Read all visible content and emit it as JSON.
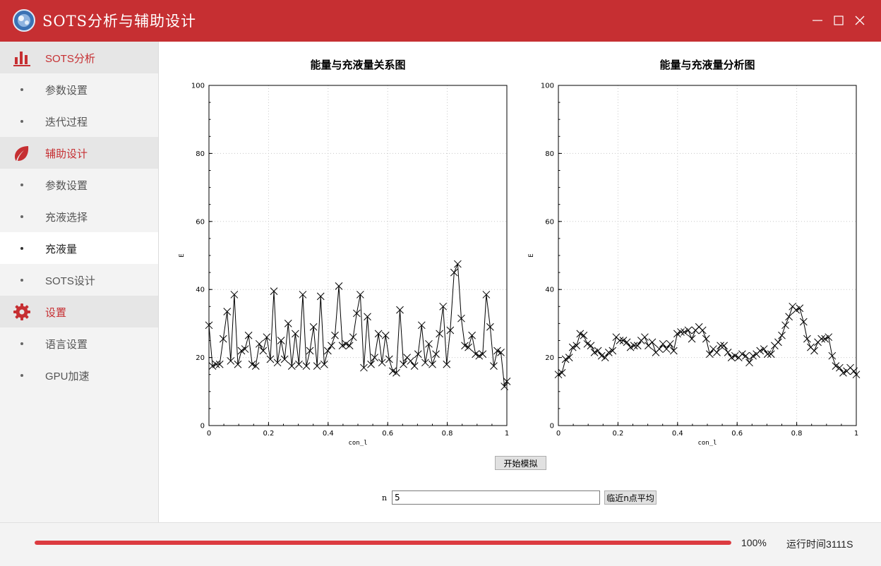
{
  "app": {
    "title": "SOTS分析与辅助设计"
  },
  "window_controls": {
    "minimize": "minimize-icon",
    "maximize": "maximize-icon",
    "close": "close-icon"
  },
  "colors": {
    "brand": "#c62f32",
    "progress": "#dc3b40",
    "sidebar_bg": "#f3f3f3"
  },
  "sidebar": {
    "groups": [
      {
        "label": "SOTS分析",
        "icon": "bar-chart-icon",
        "items": [
          {
            "label": "参数设置"
          },
          {
            "label": "迭代过程"
          }
        ]
      },
      {
        "label": "辅助设计",
        "icon": "leaf-icon",
        "items": [
          {
            "label": "参数设置"
          },
          {
            "label": "充液选择"
          },
          {
            "label": "充液量",
            "active": true
          },
          {
            "label": "SOTS设计"
          }
        ]
      },
      {
        "label": "设置",
        "icon": "gear-icon",
        "items": [
          {
            "label": "语言设置"
          },
          {
            "label": "GPU加速"
          }
        ]
      }
    ]
  },
  "controls": {
    "start_button": "开始模拟",
    "n_label": "n",
    "n_value": "5",
    "average_button": "临近n点平均"
  },
  "status": {
    "progress_text": "100%",
    "progress_fraction": 1.0,
    "runtime": "运行时间3111S"
  },
  "chart_data": [
    {
      "type": "line",
      "title": "能量与充液量关系图",
      "xlabel": "con_l",
      "ylabel": "E",
      "xlim": [
        0,
        1
      ],
      "ylim": [
        0,
        100
      ],
      "xticks": [
        "0",
        "0.2",
        "0.4",
        "0.6",
        "0.8",
        "1"
      ],
      "yticks": [
        "0",
        "20",
        "40",
        "60",
        "80",
        "100"
      ],
      "grid": true,
      "marker": "x",
      "series": [
        {
          "x": [
            0.0,
            0.012,
            0.024,
            0.036,
            0.048,
            0.061,
            0.073,
            0.085,
            0.097,
            0.109,
            0.121,
            0.133,
            0.145,
            0.157,
            0.169,
            0.182,
            0.194,
            0.206,
            0.218,
            0.23,
            0.242,
            0.254,
            0.266,
            0.278,
            0.29,
            0.302,
            0.315,
            0.327,
            0.339,
            0.351,
            0.363,
            0.375,
            0.387,
            0.399,
            0.411,
            0.423,
            0.436,
            0.448,
            0.46,
            0.472,
            0.484,
            0.496,
            0.508,
            0.52,
            0.532,
            0.544,
            0.556,
            0.569,
            0.581,
            0.593,
            0.605,
            0.617,
            0.629,
            0.641,
            0.653,
            0.665,
            0.677,
            0.69,
            0.702,
            0.714,
            0.726,
            0.738,
            0.75,
            0.762,
            0.774,
            0.786,
            0.798,
            0.81,
            0.823,
            0.835,
            0.847,
            0.859,
            0.871,
            0.883,
            0.895,
            0.907,
            0.919,
            0.931,
            0.944,
            0.956,
            0.968,
            0.98,
            0.992,
            1.0
          ],
          "y": [
            29.5,
            17.5,
            18,
            18,
            25.5,
            33.5,
            19,
            38.5,
            18,
            22,
            22.5,
            26.5,
            18,
            17.5,
            24,
            22,
            26,
            19.5,
            39.5,
            18.5,
            25,
            19.5,
            30,
            17.5,
            27,
            18,
            38.5,
            17.5,
            22,
            29,
            17.5,
            38,
            18,
            22,
            23.5,
            26.5,
            41,
            23.5,
            24,
            23.5,
            26,
            33,
            38.5,
            17,
            32,
            18,
            20,
            27,
            18.5,
            26.5,
            19.5,
            16,
            15.5,
            34,
            18,
            20,
            19,
            17.5,
            21,
            29.5,
            18.5,
            24,
            18,
            21,
            27,
            35,
            18,
            28,
            45,
            47.5,
            31.5,
            23.5,
            23,
            26.5,
            21,
            20.5,
            21,
            38.5,
            29,
            17.5,
            22,
            21.5,
            11.5,
            13
          ]
        }
      ]
    },
    {
      "type": "line",
      "title": "能量与充液量分析图",
      "xlabel": "con_l",
      "ylabel": "E",
      "xlim": [
        0,
        1
      ],
      "ylim": [
        0,
        100
      ],
      "xticks": [
        "0",
        "0.2",
        "0.4",
        "0.6",
        "0.8",
        "1"
      ],
      "yticks": [
        "0",
        "20",
        "40",
        "60",
        "80",
        "100"
      ],
      "grid": true,
      "marker": "x",
      "series": [
        {
          "x": [
            0.0,
            0.012,
            0.024,
            0.036,
            0.048,
            0.061,
            0.073,
            0.085,
            0.097,
            0.109,
            0.121,
            0.133,
            0.145,
            0.157,
            0.169,
            0.182,
            0.194,
            0.206,
            0.218,
            0.23,
            0.242,
            0.254,
            0.266,
            0.278,
            0.29,
            0.302,
            0.315,
            0.327,
            0.339,
            0.351,
            0.363,
            0.375,
            0.387,
            0.399,
            0.411,
            0.423,
            0.436,
            0.448,
            0.46,
            0.472,
            0.484,
            0.496,
            0.508,
            0.52,
            0.532,
            0.544,
            0.556,
            0.569,
            0.581,
            0.593,
            0.605,
            0.617,
            0.629,
            0.641,
            0.653,
            0.665,
            0.677,
            0.69,
            0.702,
            0.714,
            0.726,
            0.738,
            0.75,
            0.762,
            0.774,
            0.786,
            0.798,
            0.81,
            0.823,
            0.835,
            0.847,
            0.859,
            0.871,
            0.883,
            0.895,
            0.907,
            0.919,
            0.931,
            0.944,
            0.956,
            0.968,
            0.98,
            0.992,
            1.0
          ],
          "y": [
            15,
            15.5,
            19.5,
            20,
            23,
            23.5,
            27,
            26.5,
            24,
            23.5,
            21.5,
            22,
            20.5,
            20,
            21.5,
            22,
            26,
            25,
            25,
            24.5,
            23,
            23.5,
            23.5,
            25,
            26,
            23.5,
            24.5,
            21.5,
            22.5,
            24,
            22.5,
            24,
            22,
            27,
            27.5,
            27.5,
            28,
            25.5,
            28,
            29,
            28,
            25.5,
            21,
            22.5,
            21.5,
            23.5,
            23.5,
            21.5,
            20,
            20.5,
            20,
            21,
            20.5,
            18.5,
            20.5,
            21,
            22,
            22.5,
            21,
            21,
            23.5,
            24.5,
            26.5,
            29.5,
            32,
            35,
            34,
            34.5,
            30.5,
            25.5,
            23,
            22,
            24.5,
            25.5,
            25.5,
            26,
            20.5,
            17.5,
            17,
            15.5,
            16,
            17,
            16,
            15
          ]
        }
      ]
    }
  ]
}
